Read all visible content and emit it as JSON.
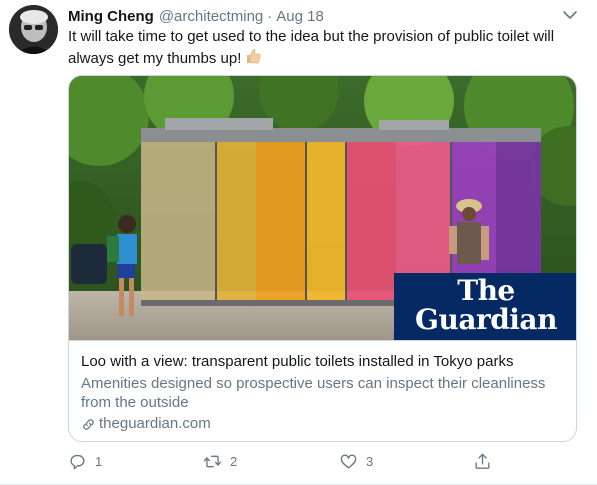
{
  "tweet": {
    "author_name": "Ming Cheng",
    "handle": "@architectming",
    "separator": "·",
    "date": "Aug 18",
    "text": "It will take time to get used to the idea but the provision of public toilet will always get my thumbs up!",
    "emoji_icon": "thumbs-up-icon"
  },
  "card": {
    "brand_line1": "The",
    "brand_line2": "Guardian",
    "title": "Loo with a view: transparent public toilets installed in Tokyo parks",
    "description": "Amenities designed so prospective users can inspect their cleanliness from the outside",
    "domain": "theguardian.com",
    "brand_color": "#052962"
  },
  "actions": {
    "reply_count": "1",
    "retweet_count": "2",
    "like_count": "3",
    "share_count": ""
  },
  "colors": {
    "text": "#14171a",
    "secondary": "#657786",
    "border": "#ccd6dd"
  }
}
